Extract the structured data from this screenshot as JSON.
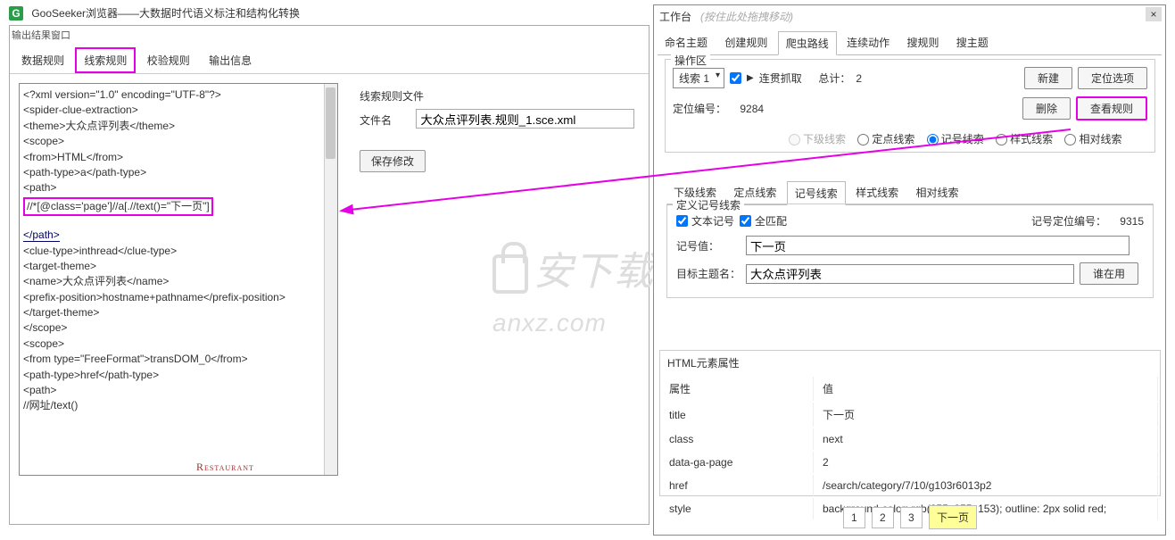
{
  "app": {
    "title": "GooSeeker浏览器——大数据时代语义标注和结构化转换",
    "logo_text": "G"
  },
  "left": {
    "output_label": "输出结果窗口",
    "tabs": [
      "数据规则",
      "线索规则",
      "校验规则",
      "输出信息"
    ],
    "active_tab": 1,
    "xml_lines_pre": [
      "<?xml version=\"1.0\" encoding=\"UTF-8\"?>",
      "<spider-clue-extraction>",
      "<theme>大众点评列表</theme>",
      "<scope>",
      "<from>HTML</from>",
      "<path-type>a</path-type>",
      "<path>"
    ],
    "xpath_highlight": "//*[@class='page']//a[.//text()=\"下一页\"]",
    "xml_lines_post": [
      "</path>",
      "<clue-type>inthread</clue-type>",
      "<target-theme>",
      "<name>大众点评列表</name>",
      "<prefix-position>hostname+pathname</prefix-position>",
      "</target-theme>",
      "</scope>",
      "<scope>",
      "<from type=\"FreeFormat\">transDOM_0</from>",
      "<path-type>href</path-type>",
      "<path>",
      "//网址/text()"
    ],
    "rule_file_label": "线索规则文件",
    "file_name_label": "文件名",
    "file_name_value": "大众点评列表.规则_1.sce.xml",
    "save_btn": "保存修改"
  },
  "workbench": {
    "title": "工作台",
    "hint": "(按住此处拖拽移动)",
    "tabs": [
      "命名主题",
      "创建规则",
      "爬虫路线",
      "连续动作",
      "搜规则",
      "搜主题"
    ],
    "active_tab": 2,
    "op_area_title": "操作区",
    "clue_select": "线索 1",
    "continuous_crawl": "连贯抓取",
    "total_label": "总计：",
    "total_value": "2",
    "new_btn": "新建",
    "locate_opts_btn": "定位选项",
    "locate_no_label": "定位编号：",
    "locate_no_value": "9284",
    "delete_btn": "删除",
    "view_rules_btn": "查看规则",
    "radio_options": [
      "下级线索",
      "定点线索",
      "记号线索",
      "样式线索",
      "相对线索"
    ],
    "radio_selected": 2,
    "sub_tabs": [
      "下级线索",
      "定点线索",
      "记号线索",
      "样式线索",
      "相对线索"
    ],
    "sub_tab_active": 2,
    "define_title": "定义记号线索",
    "chk_text_mark": "文本记号",
    "chk_full_match": "全匹配",
    "mark_locate_no_label": "记号定位编号：",
    "mark_locate_no_value": "9315",
    "mark_value_label": "记号值：",
    "mark_value": "下一页",
    "target_theme_label": "目标主题名：",
    "target_theme_value": "大众点评列表",
    "who_using_btn": "谁在用",
    "html_attr_title": "HTML元素属性",
    "attr_head_prop": "属性",
    "attr_head_val": "值",
    "attrs": [
      {
        "k": "title",
        "v": "下一页"
      },
      {
        "k": "class",
        "v": "next"
      },
      {
        "k": "data-ga-page",
        "v": "2"
      },
      {
        "k": "href",
        "v": "/search/category/7/10/g103r6013p2"
      },
      {
        "k": "style",
        "v": "background-color: rgb(255, 255, 153); outline: 2px solid red;"
      }
    ],
    "pager": [
      "1",
      "2",
      "3",
      "下一页"
    ],
    "pager_active": 3
  },
  "watermark": {
    "cn": "安下载",
    "en": "anxz.com"
  },
  "misc": {
    "restaurant": "Restaurant"
  }
}
